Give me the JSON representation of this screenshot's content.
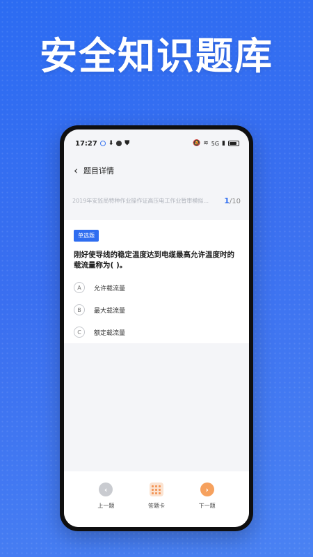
{
  "promo": {
    "title": "安全知识题库"
  },
  "status_bar": {
    "time": "17:27",
    "network": "5G"
  },
  "nav": {
    "back_icon": "chevron-left-icon",
    "title": "题目详情"
  },
  "exam": {
    "name": "2019年安监局特种作业操作证高压电工作业暂审模拟...",
    "current": "1",
    "total": "/10"
  },
  "question": {
    "type_tag": "单选题",
    "text": "刚好使导线的稳定温度达到电缆最高允许温度时的载流量称为( )。",
    "options": [
      {
        "letter": "A",
        "text": "允许载流量"
      },
      {
        "letter": "B",
        "text": "最大载流量"
      },
      {
        "letter": "C",
        "text": "额定载流量"
      }
    ]
  },
  "toolbar": {
    "prev_label": "上一题",
    "card_label": "答题卡",
    "next_label": "下一题"
  },
  "colors": {
    "accent": "#2e6df0",
    "next": "#f6a15e",
    "background": "#3a6ff0"
  }
}
